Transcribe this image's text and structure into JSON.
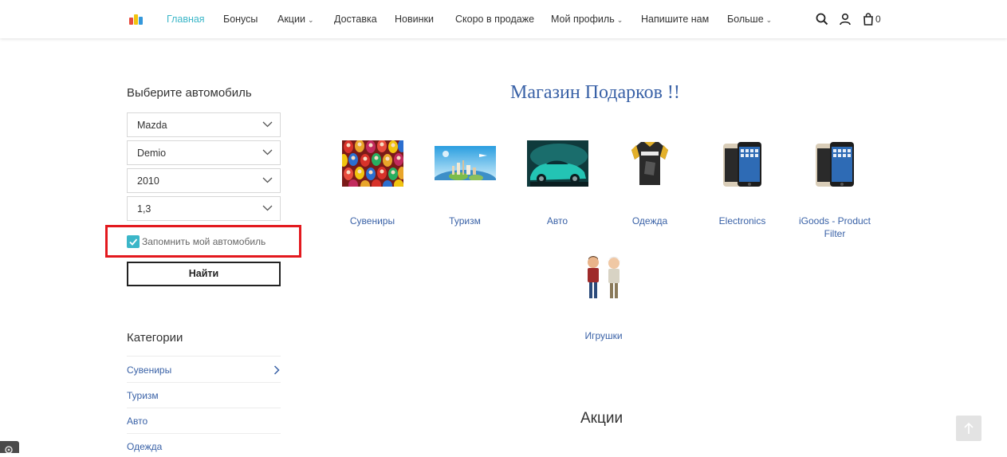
{
  "header": {
    "nav": [
      {
        "label": "Главная",
        "dropdown": false,
        "active": true
      },
      {
        "label": "Бонусы",
        "dropdown": false,
        "active": false
      },
      {
        "label": "Акции",
        "dropdown": true,
        "active": false
      },
      {
        "label": "Доставка",
        "dropdown": false,
        "active": false
      },
      {
        "label": "Новинки",
        "dropdown": false,
        "active": false
      },
      {
        "label": "Скоро в продаже",
        "dropdown": false,
        "active": false
      },
      {
        "label": "Мой профиль",
        "dropdown": true,
        "active": false
      },
      {
        "label": "Напишите нам",
        "dropdown": false,
        "active": false
      },
      {
        "label": "Больше",
        "dropdown": true,
        "active": false
      }
    ],
    "cart_count": "0",
    "icons": [
      "search-icon",
      "user-icon",
      "cart-icon"
    ]
  },
  "sidebar": {
    "car_title": "Выберите автомобиль",
    "selects": [
      "Mazda",
      "Demio",
      "2010",
      "1,3"
    ],
    "remember_label": "Запомнить мой автомобиль",
    "remember_checked": true,
    "find_button": "Найти",
    "categories_title": "Категории",
    "categories": [
      "Сувениры",
      "Туризм",
      "Авто",
      "Одежда"
    ]
  },
  "main": {
    "shop_title": "Магазин Подарков !!",
    "tiles": [
      {
        "label": "Сувениры",
        "image": "matryoshka-dolls"
      },
      {
        "label": "Туризм",
        "image": "travel-globe"
      },
      {
        "label": "Авто",
        "image": "sports-car"
      },
      {
        "label": "Одежда",
        "image": "cycling-jersey"
      },
      {
        "label": "Electronics",
        "image": "smartphone"
      },
      {
        "label": "iGoods - Product Filter",
        "image": "smartphone"
      },
      {
        "label": "Игрушки",
        "image": "toy-figures"
      }
    ],
    "promo_title": "Акции"
  },
  "colors": {
    "accent": "#3bb6c8",
    "link": "#3a62a7",
    "highlight": "#e3191e"
  }
}
